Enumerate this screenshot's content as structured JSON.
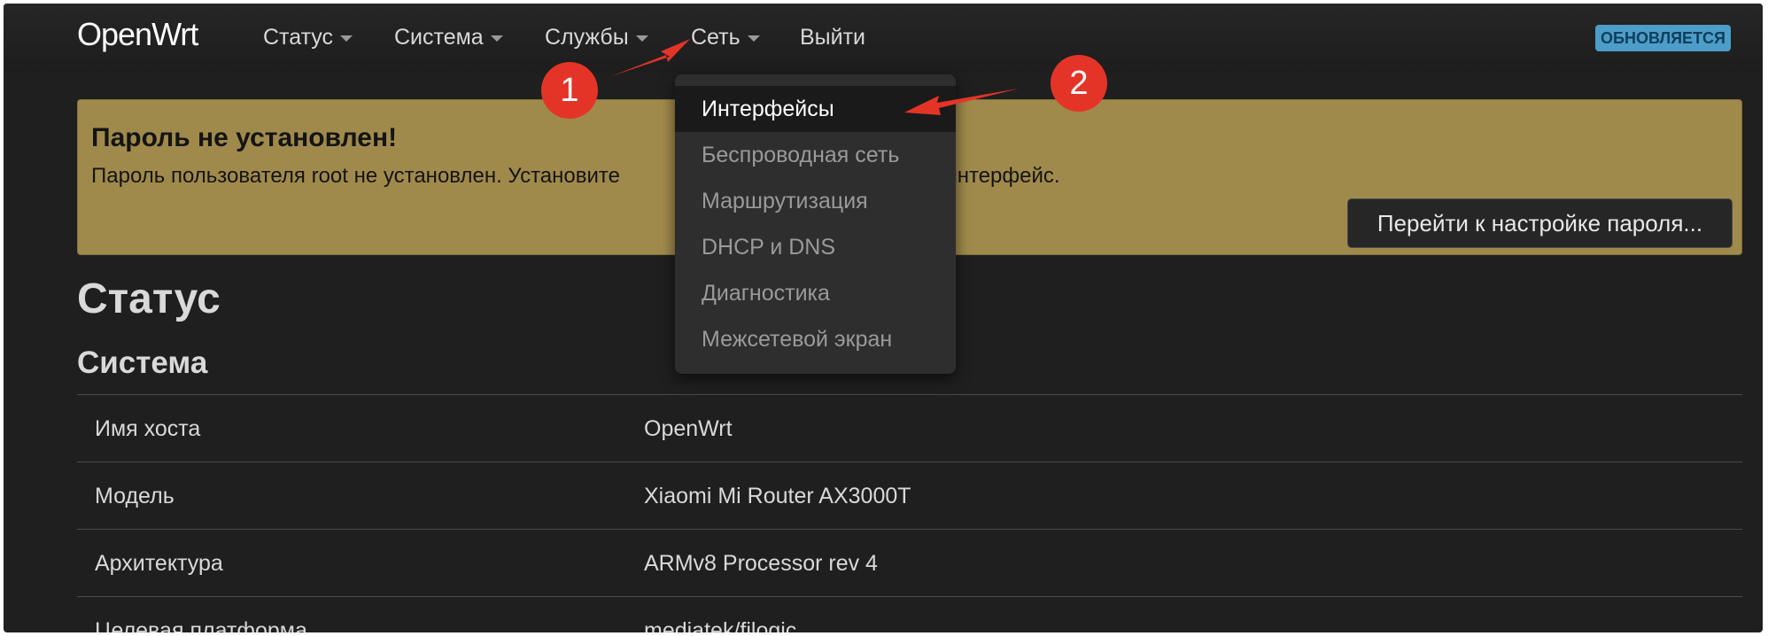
{
  "navbar": {
    "brand": "OpenWrt",
    "items": [
      {
        "label": "Статус",
        "dropdown": true
      },
      {
        "label": "Система",
        "dropdown": true
      },
      {
        "label": "Службы",
        "dropdown": true
      },
      {
        "label": "Сеть",
        "dropdown": true
      },
      {
        "label": "Выйти",
        "dropdown": false
      }
    ],
    "badge": "ОБНОВЛЯЕТСЯ"
  },
  "alert": {
    "title": "Пароль не установлен!",
    "text": "Пароль пользователя root не установлен. Установите                                                веб-интерфейс.",
    "button": "Перейти к настройке пароля..."
  },
  "page": {
    "title": "Статус",
    "section": "Система"
  },
  "system_table": [
    {
      "key": "Имя хоста",
      "value": "OpenWrt"
    },
    {
      "key": "Модель",
      "value": "Xiaomi Mi Router AX3000T"
    },
    {
      "key": "Архитектура",
      "value": "ARMv8 Processor rev 4"
    },
    {
      "key": "Целевая платформа",
      "value": "mediatek/filogic"
    }
  ],
  "network_menu": {
    "items": [
      {
        "label": "Интерфейсы",
        "active": true
      },
      {
        "label": "Беспроводная сеть",
        "active": false
      },
      {
        "label": "Маршрутизация",
        "active": false
      },
      {
        "label": "DHCP и DNS",
        "active": false
      },
      {
        "label": "Диагностика",
        "active": false
      },
      {
        "label": "Межсетевой экран",
        "active": false
      }
    ]
  },
  "annotations": {
    "marker1": "1",
    "marker2": "2"
  },
  "colors": {
    "background": "#1f1f1f",
    "alert": "#a08a4b",
    "badge": "#4d9dc9",
    "annotation": "#e43427"
  }
}
